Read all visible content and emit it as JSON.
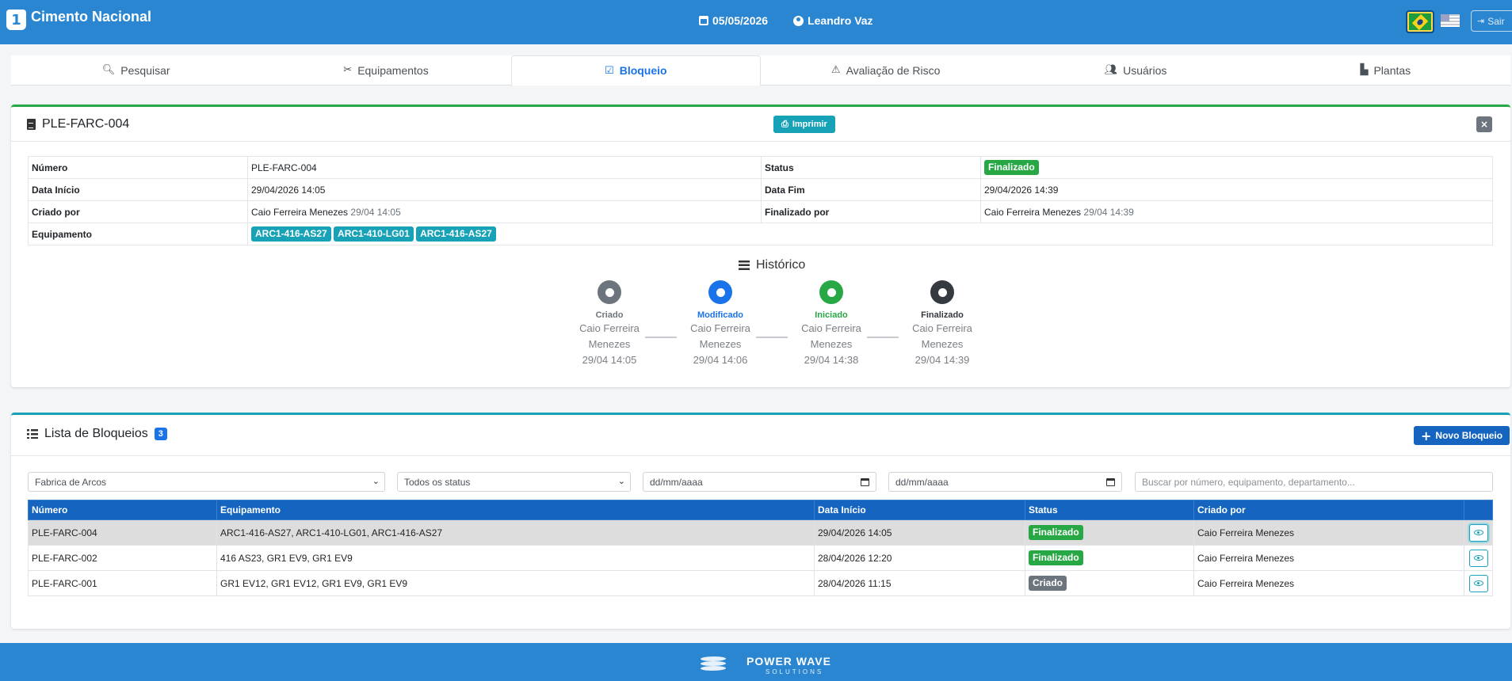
{
  "app": {
    "title": "Cimento Nacional",
    "logo_letter": "1"
  },
  "header": {
    "date": "05/05/2026",
    "user": "Leandro Vaz",
    "logout_label": "Sair"
  },
  "tabs": [
    {
      "label": "Pesquisar",
      "icon": "search-icon"
    },
    {
      "label": "Equipamentos",
      "icon": "tools-icon"
    },
    {
      "label": "Bloqueio",
      "icon": "clipboard-check-icon",
      "active": true
    },
    {
      "label": "Avaliação de Risco",
      "icon": "warning-icon"
    },
    {
      "label": "Usuários",
      "icon": "users-icon"
    },
    {
      "label": "Plantas",
      "icon": "industry-icon"
    }
  ],
  "detail": {
    "title": "PLE-FARC-004",
    "print_label": "Imprimir",
    "close_label": "×",
    "fields": {
      "numero_label": "Número",
      "numero": "PLE-FARC-004",
      "status_label": "Status",
      "status": "Finalizado",
      "data_inicio_label": "Data Início",
      "data_inicio": "29/04/2026 14:05",
      "data_fim_label": "Data Fim",
      "data_fim": "29/04/2026 14:39",
      "criado_por_label": "Criado por",
      "criado_por": "Caio Ferreira Menezes",
      "criado_em": "29/04 14:05",
      "finalizado_por_label": "Finalizado por",
      "finalizado_por": "Caio Ferreira Menezes",
      "finalizado_em": "29/04 14:39",
      "equipamento_label": "Equipamento",
      "equipamentos": [
        "ARC1-416-AS27",
        "ARC1-410-LG01",
        "ARC1-416-AS27"
      ]
    },
    "history_title": "Histórico",
    "history": [
      {
        "label": "Criado",
        "name_line1": "Caio Ferreira",
        "name_line2": "Menezes",
        "time": "29/04 14:05",
        "color": "#6c757d"
      },
      {
        "label": "Modificado",
        "name_line1": "Caio Ferreira",
        "name_line2": "Menezes",
        "time": "29/04 14:06",
        "color": "#1a73e8"
      },
      {
        "label": "Iniciado",
        "name_line1": "Caio Ferreira",
        "name_line2": "Menezes",
        "time": "29/04 14:38",
        "color": "#28a745"
      },
      {
        "label": "Finalizado",
        "name_line1": "Caio Ferreira",
        "name_line2": "Menezes",
        "time": "29/04 14:39",
        "color": "#343a40"
      }
    ]
  },
  "list": {
    "title": "Lista de Bloqueios",
    "count": "3",
    "new_label": "Novo Bloqueio",
    "filters": {
      "plant": "Fabrica de Arcos",
      "status": "Todos os status",
      "date_from": "dd/mm/aaaa",
      "date_to": "dd/mm/aaaa",
      "search_placeholder": "Buscar por número, equipamento, departamento..."
    },
    "columns": [
      "Número",
      "Equipamento",
      "Data Início",
      "Status",
      "Criado por"
    ],
    "rows": [
      {
        "numero": "PLE-FARC-004",
        "equipamento": "ARC1-416-AS27, ARC1-410-LG01, ARC1-416-AS27",
        "data_inicio": "29/04/2026 14:05",
        "status": "Finalizado",
        "criado_por": "Caio Ferreira Menezes",
        "selected": true
      },
      {
        "numero": "PLE-FARC-002",
        "equipamento": "416 AS23, GR1 EV9, GR1 EV9",
        "data_inicio": "28/04/2026 12:20",
        "status": "Finalizado",
        "criado_por": "Caio Ferreira Menezes"
      },
      {
        "numero": "PLE-FARC-001",
        "equipamento": "GR1 EV12, GR1 EV12, GR1 EV9, GR1 EV9",
        "data_inicio": "28/04/2026 11:15",
        "status": "Criado",
        "criado_por": "Caio Ferreira Menezes"
      }
    ]
  },
  "footer": {
    "brand": "POWER WAVE",
    "sub": "SOLUTIONS"
  },
  "colors": {
    "primary": "#2a86d0",
    "success": "#28a745",
    "info": "#17a2b8",
    "secondary": "#6c757d",
    "table_header": "#1565c0"
  }
}
